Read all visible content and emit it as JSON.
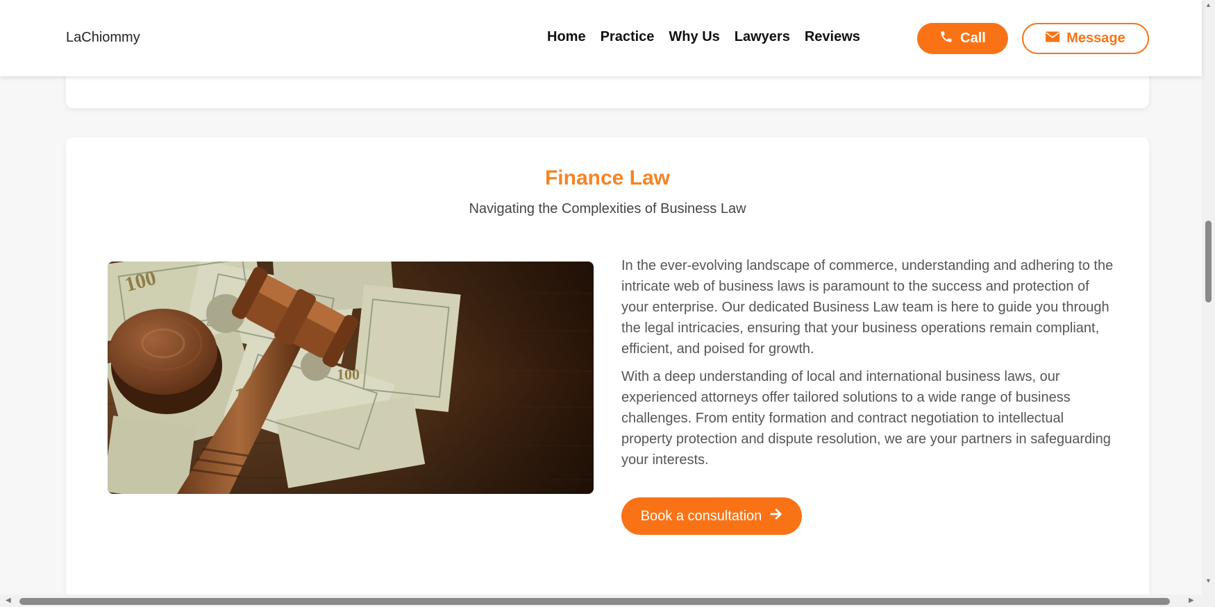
{
  "header": {
    "brand": "LaChiommy",
    "nav": [
      "Home",
      "Practice",
      "Why Us",
      "Lawyers",
      "Reviews"
    ],
    "call_label": "Call",
    "message_label": "Message",
    "call_icon": "phone-icon",
    "message_icon": "envelope-icon"
  },
  "section": {
    "title": "Finance Law",
    "subtitle": "Navigating the Complexities of Business Law",
    "paragraph1": "In the ever-evolving landscape of commerce, understanding and adhering to the intricate web of business laws is paramount to the success and protection of your enterprise. Our dedicated Business Law team is here to guide you through the legal intricacies, ensuring that your business operations remain compliant, efficient, and poised for growth.",
    "paragraph2": "With a deep understanding of local and international business laws, our experienced attorneys offer tailored solutions to a wide range of business challenges. From entity formation and contract negotiation to intellectual property protection and dispute resolution, we are your partners in safeguarding your interests.",
    "cta_label": "Book a consultation",
    "cta_icon": "arrow-right-icon",
    "image_description": "gavel-on-money"
  },
  "colors": {
    "accent": "#f97316",
    "title": "#f58426"
  }
}
